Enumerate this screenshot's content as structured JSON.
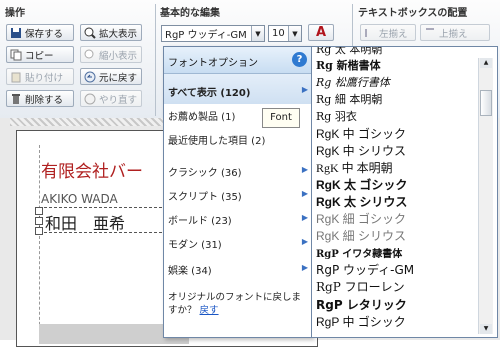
{
  "ribbon": {
    "groups": {
      "operations": "操作",
      "basic_edit": "基本的な編集",
      "textbox_layout": "テキストボックスの配置"
    },
    "buttons": {
      "save": "保存する",
      "copy": "コピー",
      "paste": "貼り付け",
      "delete": "削除する",
      "zoom_in": "拡大表示",
      "zoom_out": "縮小表示",
      "undo": "元に戻す",
      "redo": "やり直す",
      "align_left": "左揃え",
      "align_top": "上揃え"
    },
    "font_select": {
      "value": "RgP ウッディ-GM"
    },
    "size_select": {
      "value": "10"
    },
    "font_color_letter": "A"
  },
  "font_panel": {
    "header": "フォントオプション",
    "help": "?",
    "tooltip": "Font",
    "categories": [
      {
        "label": "すべて表示 (120)",
        "selected": true
      },
      {
        "label": "お薦め製品 (1)"
      },
      {
        "label": "最近使用した項目 (2)"
      },
      {
        "label": "クラシック (36)"
      },
      {
        "label": "スクリプト (35)"
      },
      {
        "label": "ボールド (23)"
      },
      {
        "label": "モダン (31)"
      },
      {
        "label": "娯楽 (34)"
      }
    ],
    "restore_text": "オリジナルのフォントに戻しますか？",
    "restore_link": "戻す"
  },
  "font_list": [
    "Rg 太 本明朝",
    "Rg 新楷書体",
    "Rg 松鷹行書体",
    "Rg 細 本明朝",
    "Rg 羽衣",
    "RgK 中 ゴシック",
    "RgK 中 シリウス",
    "RgK 中 本明朝",
    "RgK 太 ゴシック",
    "RgK 太 シリウス",
    "RgK 細 ゴシック",
    "RgK 細 シリウス",
    "RgP イワタ隷書体",
    "RgP ウッディ-GM",
    "RgP フローレン",
    "RgP レタリック",
    "RgP 中 ゴシック"
  ],
  "document": {
    "company": "有限会社バー",
    "name_en": "AKIKO WADA",
    "name_ja": "和田　亜希"
  },
  "colors": {
    "company_text": "#b02020",
    "link": "#1a56c4",
    "panel_blue": "#c8ddf2"
  }
}
